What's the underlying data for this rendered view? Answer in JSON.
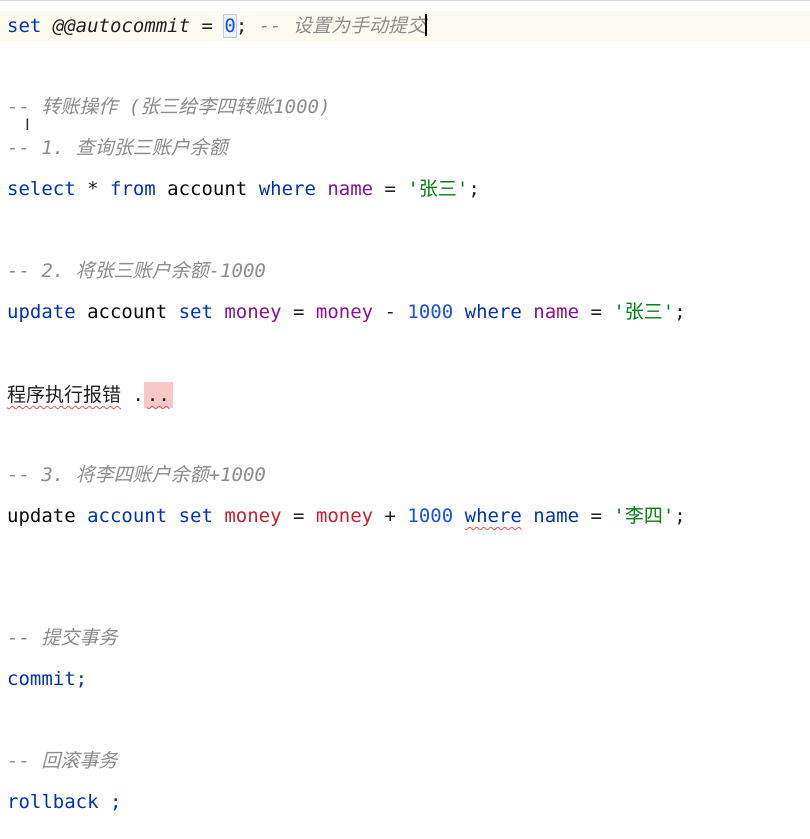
{
  "editor": {
    "lines": {
      "autocommit": {
        "kw_set": "set",
        "var": "@@autocommit",
        "eq": " = ",
        "zero": "0",
        "semi": ";",
        "comment": " -- 设置为手动提交"
      },
      "comment_transfer": "-- 转账操作 (张三给李四转账1000)",
      "comment_step1": "-- 1. 查询张三账户余额",
      "select": {
        "kw_select": "select",
        "star": " * ",
        "kw_from": "from",
        "table": " account ",
        "kw_where": "where",
        "col_name": " name",
        "eq": " = ",
        "str": "'张三'",
        "semi": ";"
      },
      "comment_step2": "-- 2. 将张三账户余额-1000",
      "update1": {
        "kw_update": "update",
        "table": " account ",
        "kw_set": "set",
        "col_money": " money",
        "eq": " = ",
        "col_money2": "money",
        "op": " - ",
        "num": "1000",
        "kw_where": " where",
        "col_name": " name",
        "eq2": " = ",
        "str": "'张三'",
        "semi": ";"
      },
      "error_line": {
        "text": "程序执行报错",
        "dots_1": " .",
        "dots_2": ".."
      },
      "comment_step3": "-- 3. 将李四账户余额+1000",
      "update2": {
        "kw_update": "update",
        "table": " account",
        "kw_set": " set",
        "col_money": " money",
        "eq": " = ",
        "col_money2": "money",
        "op": " + ",
        "num": "1000",
        "space": " ",
        "kw_where": "where",
        "col_name": " name",
        "eq2": " = ",
        "str": "'李四'",
        "semi": ";"
      },
      "comment_commit": "-- 提交事务",
      "commit": "commit;",
      "comment_rollback": "-- 回滚事务",
      "rollback": "rollback ;"
    }
  }
}
